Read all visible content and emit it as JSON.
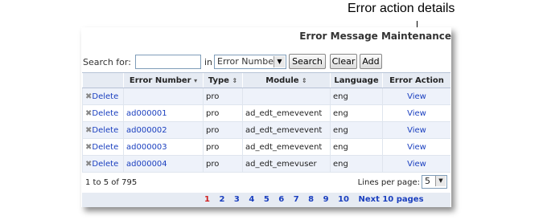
{
  "callout": {
    "label": "Error action details"
  },
  "title": "Error Message Maintenance",
  "search": {
    "label": "Search for:",
    "value": "",
    "in_label": "in",
    "field_selected": "Error Number",
    "search_button": "Search",
    "clear_button": "Clear",
    "add_button": "Add"
  },
  "table": {
    "columns": [
      "",
      "Error Number",
      "Type",
      "Module",
      "Language",
      "Error Action"
    ],
    "rows": [
      {
        "delete": "Delete",
        "error_number": "",
        "type": "pro",
        "module": "",
        "language": "eng",
        "action": "View"
      },
      {
        "delete": "Delete",
        "error_number": "ad000001",
        "type": "pro",
        "module": "ad_edt_emevevent",
        "language": "eng",
        "action": "View"
      },
      {
        "delete": "Delete",
        "error_number": "ad000002",
        "type": "pro",
        "module": "ad_edt_emevevent",
        "language": "eng",
        "action": "View"
      },
      {
        "delete": "Delete",
        "error_number": "ad000003",
        "type": "pro",
        "module": "ad_edt_emevevent",
        "language": "eng",
        "action": "View"
      },
      {
        "delete": "Delete",
        "error_number": "ad000004",
        "type": "pro",
        "module": "ad_edt_emevuser",
        "language": "eng",
        "action": "View"
      }
    ]
  },
  "footer": {
    "count_text": "1 to 5 of 795",
    "lines_per_page_label": "Lines per page:",
    "lines_per_page_value": "5"
  },
  "pager": {
    "pages": [
      "1",
      "2",
      "3",
      "4",
      "5",
      "6",
      "7",
      "8",
      "9",
      "10"
    ],
    "current": "1",
    "next_label": "Next 10 pages"
  }
}
